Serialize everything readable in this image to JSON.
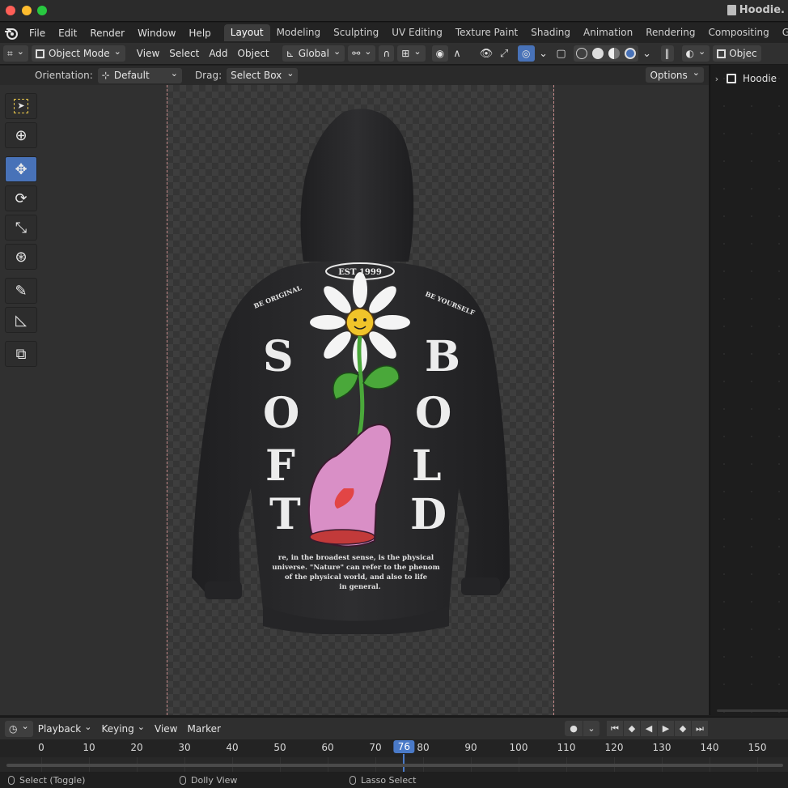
{
  "window": {
    "title": "Hoodie."
  },
  "menubar": {
    "items": [
      "File",
      "Edit",
      "Render",
      "Window",
      "Help"
    ],
    "workspaces": [
      "Layout",
      "Modeling",
      "Sculpting",
      "UV Editing",
      "Texture Paint",
      "Shading",
      "Animation",
      "Rendering",
      "Compositing",
      "Geometry Nodes"
    ],
    "active_workspace": "Layout"
  },
  "header": {
    "mode": "Object Mode",
    "menus": [
      "View",
      "Select",
      "Add",
      "Object"
    ],
    "transform_orientation": "Global",
    "right_label": "Objec"
  },
  "tool_settings": {
    "orientation_label": "Orientation:",
    "orientation_value": "Default",
    "drag_label": "Drag:",
    "drag_value": "Select Box",
    "options_label": "Options"
  },
  "toolbox": {
    "tools": [
      "select-box",
      "cursor",
      "move",
      "rotate",
      "scale",
      "transform",
      "annotate",
      "measure",
      "add-cube"
    ],
    "active": "move"
  },
  "artwork": {
    "badge": "EST 1999",
    "left_arc": "BE ORIGINAL",
    "right_arc": "BE YOURSELF",
    "left_word": [
      "S",
      "O",
      "F",
      "T"
    ],
    "right_word": [
      "B",
      "O",
      "L",
      "D"
    ],
    "paragraph": [
      "re, in the broadest sense, is the physical",
      "universe. \"Nature\" can refer to the phenom",
      "of the physical world, and also to life",
      "in general."
    ]
  },
  "outliner": {
    "item": "Hoodie"
  },
  "timeline": {
    "menus": [
      "Playback",
      "Keying",
      "View",
      "Marker"
    ],
    "ticks": [
      "0",
      "10",
      "20",
      "30",
      "40",
      "50",
      "60",
      "70",
      "80",
      "90",
      "100",
      "110",
      "120",
      "130",
      "140",
      "150"
    ],
    "current_frame": "76"
  },
  "statusbar": {
    "left": "Select (Toggle)",
    "middle": "Dolly View",
    "right": "Lasso Select"
  },
  "colors": {
    "accent": "#4a7ac8",
    "hoodie": "#2a2a2c",
    "flower_center": "#f0c42a",
    "hand": "#d98fc6",
    "leaf": "#4aa83a"
  }
}
